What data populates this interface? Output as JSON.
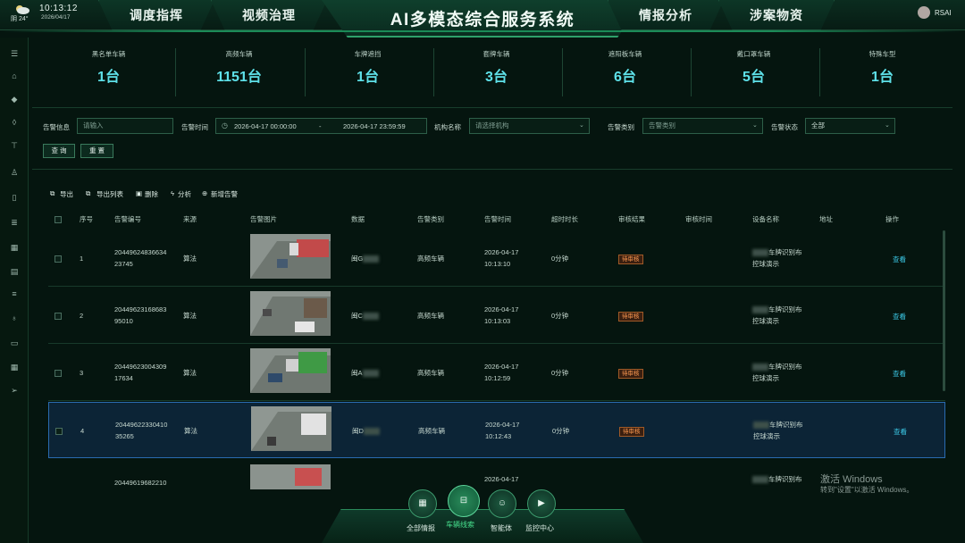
{
  "header": {
    "weather": "阴 24°",
    "time": "10:13:12",
    "date": "2026/04/17",
    "title": "AI多模态综合服务系统",
    "nav_left": [
      "调度指挥",
      "视频治理"
    ],
    "nav_right": [
      "情报分析",
      "涉案物资"
    ],
    "user": "RSAI"
  },
  "sidebar": {
    "icons": [
      "menu-icon",
      "home-icon",
      "tag-icon",
      "shield-icon",
      "brush-icon",
      "user-icon",
      "document-icon",
      "list-icon",
      "grid-icon",
      "id-card-icon",
      "list-lines-icon",
      "bulb-icon",
      "folder-icon",
      "table-icon",
      "send-icon"
    ]
  },
  "stats": [
    {
      "label": "黑名单车辆",
      "value": "1台"
    },
    {
      "label": "高频车辆",
      "value": "1151台"
    },
    {
      "label": "车牌遮挡",
      "value": "1台"
    },
    {
      "label": "套牌车辆",
      "value": "3台"
    },
    {
      "label": "遮阳板车辆",
      "value": "6台"
    },
    {
      "label": "戴口罩车辆",
      "value": "5台"
    },
    {
      "label": "特殊车型",
      "value": "1台"
    }
  ],
  "filter": {
    "info_label": "告警信息",
    "info_placeholder": "请输入",
    "time_label": "告警时间",
    "time_start": "2026-04-17 00:00:00",
    "time_sep": "-",
    "time_end": "2026-04-17 23:59:59",
    "org_label": "机构名称",
    "org_placeholder": "请选择机构",
    "type_label": "告警类别",
    "type_placeholder": "告警类别",
    "status_label": "告警状态",
    "status_value": "全部",
    "query_btn": "查 询",
    "reset_btn": "重 置"
  },
  "toolbar": {
    "export": "导出",
    "export_list": "导出列表",
    "delete": "删除",
    "analyze": "分析",
    "add_alert": "新增告警"
  },
  "table": {
    "headers": [
      "序号",
      "告警编号",
      "来源",
      "告警图片",
      "数据",
      "告警类别",
      "告警时间",
      "超时时长",
      "审核结果",
      "审核时间",
      "设备名称",
      "地址",
      "操作"
    ],
    "rows": [
      {
        "no": "1",
        "id_l1": "20449624836634",
        "id_l2": "23745",
        "source": "算法",
        "data": "闽G",
        "category": "高频车辆",
        "time_l1": "2026-04-17",
        "time_l2": "10:13:10",
        "timeout": "0分钟",
        "review": "待审核",
        "device_l1": "车牌识别布",
        "device_l2": "控球演示",
        "action": "查看"
      },
      {
        "no": "2",
        "id_l1": "20449623168683",
        "id_l2": "95010",
        "source": "算法",
        "data": "闽C",
        "category": "高频车辆",
        "time_l1": "2026-04-17",
        "time_l2": "10:13:03",
        "timeout": "0分钟",
        "review": "待审核",
        "device_l1": "车牌识别布",
        "device_l2": "控球演示",
        "action": "查看"
      },
      {
        "no": "3",
        "id_l1": "20449623004309",
        "id_l2": "17634",
        "source": "算法",
        "data": "闽A",
        "category": "高频车辆",
        "time_l1": "2026-04-17",
        "time_l2": "10:12:59",
        "timeout": "0分钟",
        "review": "待审核",
        "device_l1": "车牌识别布",
        "device_l2": "控球演示",
        "action": "查看"
      },
      {
        "no": "4",
        "id_l1": "20449622330410",
        "id_l2": "35265",
        "source": "算法",
        "data": "闽D",
        "category": "高频车辆",
        "time_l1": "2026-04-17",
        "time_l2": "10:12:43",
        "timeout": "0分钟",
        "review": "待审核",
        "device_l1": "车牌识别布",
        "device_l2": "控球演示",
        "action": "查看"
      },
      {
        "no": "",
        "id_l1": "20449619682210",
        "id_l2": "",
        "source": "",
        "data": "",
        "category": "",
        "time_l1": "2026-04-17",
        "time_l2": "",
        "timeout": "",
        "review": "",
        "device_l1": "车牌识别布",
        "device_l2": "",
        "action": ""
      }
    ]
  },
  "dock": {
    "labels": [
      "全部情报",
      "车辆线索",
      "智能体",
      "监控中心"
    ],
    "active": "车辆线索"
  },
  "watermark": {
    "line1": "激活 Windows",
    "line2": "转到\"设置\"以激活 Windows。"
  },
  "colors": {
    "accent": "#5ee1e9",
    "brand": "#2ea06a",
    "badge": "#ff9b52",
    "link": "#3bc9e7"
  }
}
